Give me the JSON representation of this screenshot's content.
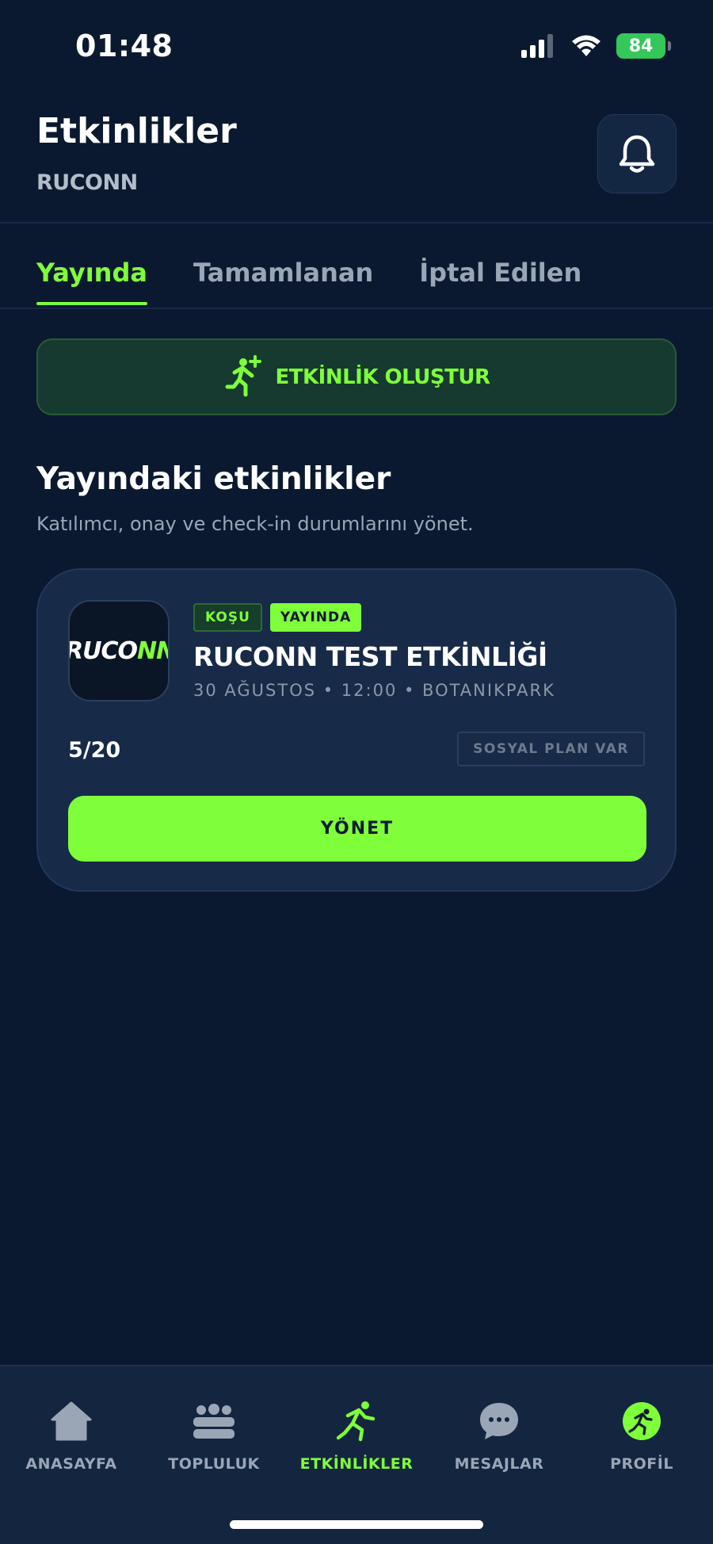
{
  "status_bar": {
    "time": "01:48",
    "battery": "84"
  },
  "header": {
    "title": "Etkinlikler",
    "subtitle": "RUCONN"
  },
  "tabs": [
    {
      "label": "Yayında",
      "active": true
    },
    {
      "label": "Tamamlanan",
      "active": false
    },
    {
      "label": "İptal Edilen",
      "active": false
    }
  ],
  "create_button": {
    "label": "ETKİNLİK OLUŞTUR"
  },
  "section": {
    "title": "Yayındaki etkinlikler",
    "description": "Katılımcı, onay ve check-in durumlarını yönet."
  },
  "event": {
    "logo_text": "RUCO",
    "logo_accent": "NN",
    "badge_type": "KOŞU",
    "badge_status": "YAYINDA",
    "title": "RUCONN TEST ETKİNLİĞİ",
    "meta": "30 AĞUSTOS • 12:00 • BOTANIKPARK",
    "participants": "5/20",
    "social_plan": "SOSYAL PLAN VAR",
    "manage_label": "YÖNET"
  },
  "bottom_nav": [
    {
      "label": "ANASAYFA",
      "icon": "home-icon",
      "active": false
    },
    {
      "label": "TOPLULUK",
      "icon": "community-icon",
      "active": false
    },
    {
      "label": "ETKİNLİKLER",
      "icon": "running-icon",
      "active": true
    },
    {
      "label": "MESAJLAR",
      "icon": "chat-icon",
      "active": false
    },
    {
      "label": "PROFİL",
      "icon": "profile-icon",
      "active": false
    }
  ],
  "colors": {
    "background": "#0b1930",
    "accent": "#7fff3a",
    "card": "#172a48"
  }
}
